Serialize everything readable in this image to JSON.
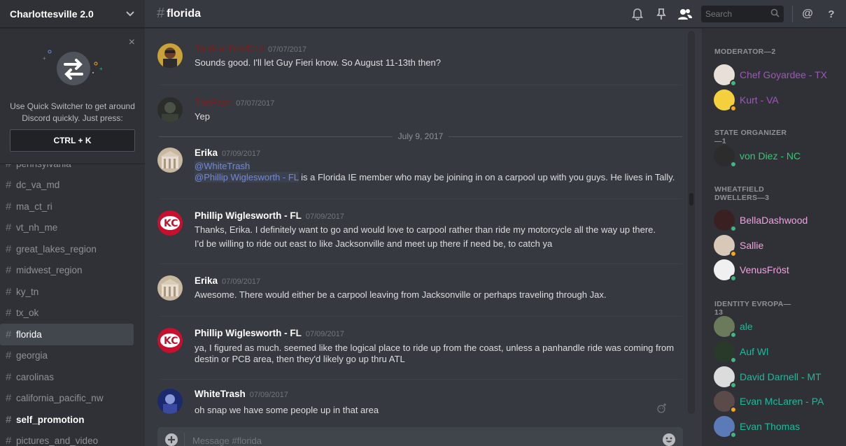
{
  "guild": {
    "name": "Charlottesville 2.0"
  },
  "quickswitch": {
    "close": "×",
    "text_line1": "Use Quick Switcher to get around",
    "text_line2": "Discord quickly. Just press:",
    "shortcut": "CTRL + K"
  },
  "channels": [
    {
      "name": "pennsylvania",
      "style": "normal"
    },
    {
      "name": "dc_va_md",
      "style": "normal"
    },
    {
      "name": "ma_ct_ri",
      "style": "normal"
    },
    {
      "name": "vt_nh_me",
      "style": "normal"
    },
    {
      "name": "great_lakes_region",
      "style": "normal"
    },
    {
      "name": "midwest_region",
      "style": "normal"
    },
    {
      "name": "ky_tn",
      "style": "normal"
    },
    {
      "name": "tx_ok",
      "style": "normal"
    },
    {
      "name": "florida",
      "style": "active"
    },
    {
      "name": "georgia",
      "style": "normal"
    },
    {
      "name": "carolinas",
      "style": "normal"
    },
    {
      "name": "california_pacific_nw",
      "style": "normal"
    },
    {
      "name": "self_promotion",
      "style": "bold"
    },
    {
      "name": "pictures_and_video",
      "style": "normal"
    }
  ],
  "header": {
    "hash": "#",
    "channel": "florida",
    "search_placeholder": "Search",
    "mention": "@",
    "help": "?"
  },
  "messages": [
    {
      "author": "Tactical BowlCut",
      "time": "07/07/2017",
      "lines": [
        "Sounds good. I'll let Guy Fieri know. So August 11-13th then?"
      ]
    },
    {
      "author": "TheFash",
      "time": "07/07/2017",
      "lines": [
        "Yep"
      ]
    },
    {
      "author": "Erika",
      "time": "07/09/2017",
      "mention1": "@WhiteTrash",
      "mention2": "@Phillip Wiglesworth - FL",
      "rest": " is a Florida IE member who may be joining in on a carpool up with you guys. He lives in Tally."
    },
    {
      "author": "Phillip Wiglesworth - FL",
      "time": "07/09/2017",
      "lines": [
        "Thanks, Erika. I definitely want to go and would love to carpool rather than ride my motorcycle all the way up there.",
        "I'd be willing to ride out east to like Jacksonville and meet up there if need be, to catch ya"
      ]
    },
    {
      "author": "Erika",
      "time": "07/09/2017",
      "lines": [
        "Awesome. There would either be a carpool leaving from Jacksonville or perhaps traveling through Jax."
      ]
    },
    {
      "author": "Phillip Wiglesworth - FL",
      "time": "07/09/2017",
      "lines": [
        "ya, I figured as much.  seemed like the logical place to ride up from the coast, unless a panhandle ride was coming from",
        "destin or PCB area, then they'd likely go up thru ATL"
      ]
    },
    {
      "author": "WhiteTrash",
      "time": "07/09/2017",
      "lines": [
        "oh snap we have some people up in that area"
      ]
    }
  ],
  "day_divider": "July 9, 2017",
  "composer": {
    "placeholder": "Message #florida"
  },
  "member_groups": [
    {
      "title": "MODERATOR—2",
      "members": [
        {
          "name": "Chef Goyardee - TX",
          "color": "#9b59b6",
          "status": "online"
        },
        {
          "name": "Kurt - VA",
          "color": "#9b59b6",
          "status": "idle"
        }
      ]
    },
    {
      "title": "STATE ORGANIZER—1",
      "members": [
        {
          "name": "von Diez - NC",
          "color": "#2ecc71",
          "status": "online"
        }
      ]
    },
    {
      "title": "WHEATFIELD DWELLERS—3",
      "members": [
        {
          "name": "BellaDashwood",
          "color": "#f1a3e0",
          "status": "online"
        },
        {
          "name": "Sallie",
          "color": "#f1a3e0",
          "status": "idle"
        },
        {
          "name": "VenusFröst",
          "color": "#f1a3e0",
          "status": "online"
        }
      ]
    },
    {
      "title": "IDENTITY EVROPA—13",
      "members": [
        {
          "name": "ale",
          "color": "#1abc9c",
          "status": "online"
        },
        {
          "name": "Auf Wl",
          "color": "#1abc9c",
          "status": "online"
        },
        {
          "name": "David Darnell - MT",
          "color": "#1abc9c",
          "status": "online"
        },
        {
          "name": "Evan McLaren - PA",
          "color": "#1abc9c",
          "status": "idle"
        },
        {
          "name": "Evan Thomas",
          "color": "#1abc9c",
          "status": "online"
        }
      ]
    }
  ],
  "colors": {
    "bg": "#36393f",
    "sidebar": "#2f3136",
    "accent": "#7289da",
    "online": "#43b581",
    "idle": "#faa61a"
  }
}
